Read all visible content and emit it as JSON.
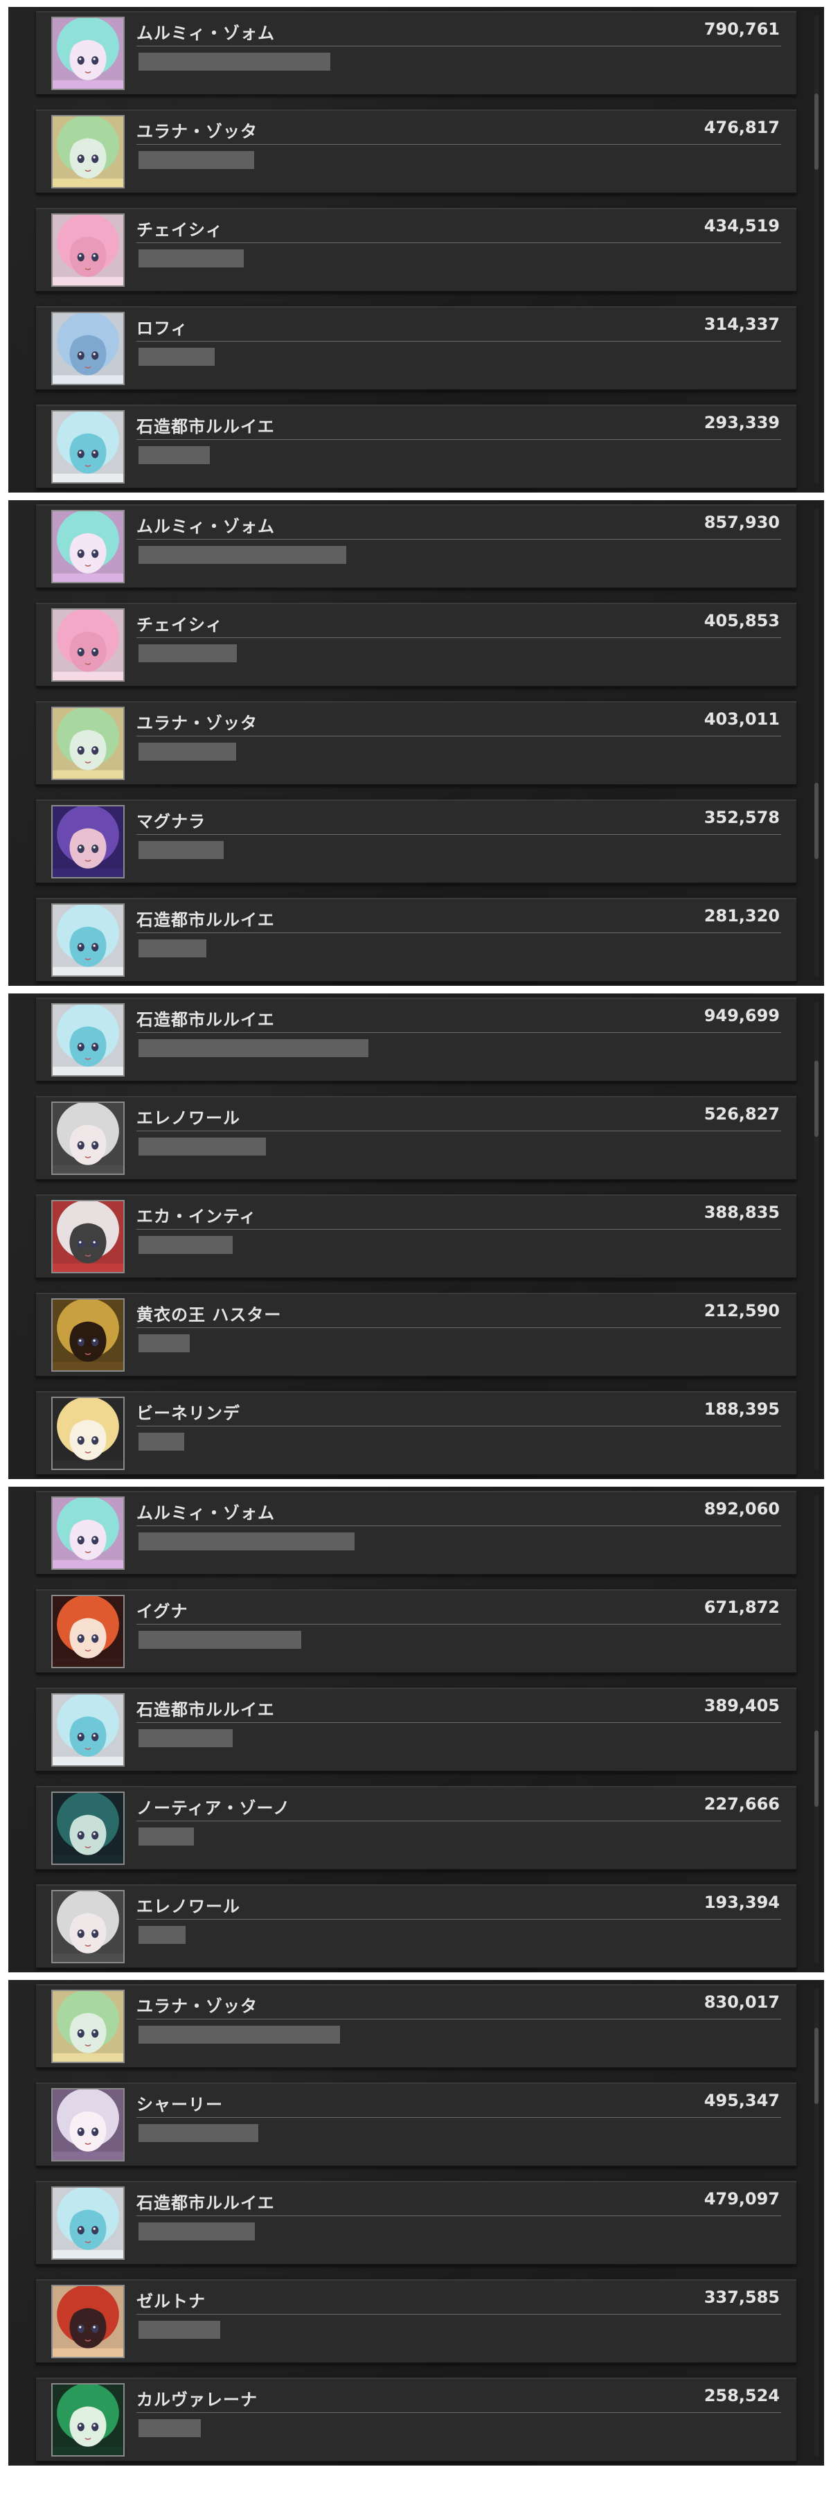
{
  "bar_max": 1000000,
  "panels": [
    {
      "scroll_fraction": 0.2,
      "entries": [
        {
          "name": "ムルミィ・ゾォム",
          "score": "790,761",
          "value": 790761,
          "avatar": "portrait-teal-hair",
          "colors": [
            "#8fe0d8",
            "#e0b8e8",
            "#f4e6f4"
          ]
        },
        {
          "name": "ユラナ・ゾッタ",
          "score": "476,817",
          "value": 476817,
          "avatar": "portrait-green-hair",
          "colors": [
            "#a8d8a0",
            "#f0e0a0",
            "#dfeee0"
          ]
        },
        {
          "name": "チェイシィ",
          "score": "434,519",
          "value": 434519,
          "avatar": "portrait-pink-hair",
          "colors": [
            "#f4a8c8",
            "#fce0ec",
            "#e89ab8"
          ]
        },
        {
          "name": "ロフィ",
          "score": "314,337",
          "value": 314337,
          "avatar": "portrait-silver-hair",
          "colors": [
            "#a8c8e8",
            "#e8f0f8",
            "#7fa8d0"
          ]
        },
        {
          "name": "石造都市ルルイエ",
          "score": "293,339",
          "value": 293339,
          "avatar": "portrait-cyan-white-hair",
          "colors": [
            "#bfe8f0",
            "#f0f4f8",
            "#6fc8d8"
          ]
        }
      ]
    },
    {
      "scroll_fraction": 0.7,
      "entries": [
        {
          "name": "ムルミィ・ゾォム",
          "score": "857,930",
          "value": 857930,
          "avatar": "portrait-teal-hair",
          "colors": [
            "#8fe0d8",
            "#e0b8e8",
            "#f4e6f4"
          ]
        },
        {
          "name": "チェイシィ",
          "score": "405,853",
          "value": 405853,
          "avatar": "portrait-pink-hair",
          "colors": [
            "#f4a8c8",
            "#fce0ec",
            "#e89ab8"
          ]
        },
        {
          "name": "ユラナ・ゾッタ",
          "score": "403,011",
          "value": 403011,
          "avatar": "portrait-green-hair",
          "colors": [
            "#a8d8a0",
            "#f0e0a0",
            "#dfeee0"
          ]
        },
        {
          "name": "マグナラ",
          "score": "352,578",
          "value": 352578,
          "avatar": "portrait-purple-hair",
          "colors": [
            "#6a4ab0",
            "#3a2a78",
            "#e8c0d0"
          ]
        },
        {
          "name": "石造都市ルルイエ",
          "score": "281,320",
          "value": 281320,
          "avatar": "portrait-cyan-white-hair",
          "colors": [
            "#bfe8f0",
            "#f0f4f8",
            "#6fc8d8"
          ]
        }
      ]
    },
    {
      "scroll_fraction": 0.15,
      "entries": [
        {
          "name": "石造都市ルルイエ",
          "score": "949,699",
          "value": 949699,
          "avatar": "portrait-cyan-white-hair",
          "colors": [
            "#bfe8f0",
            "#f0f4f8",
            "#6fc8d8"
          ]
        },
        {
          "name": "エレノワール",
          "score": "526,827",
          "value": 526827,
          "avatar": "portrait-white-hair-dark",
          "colors": [
            "#d8d8d8",
            "#505050",
            "#f0e8e8"
          ]
        },
        {
          "name": "エカ・インティ",
          "score": "388,835",
          "value": 388835,
          "avatar": "portrait-white-hair-red",
          "colors": [
            "#e8e0e0",
            "#c84040",
            "#404040"
          ]
        },
        {
          "name": "黄衣の王 ハスター",
          "score": "212,590",
          "value": 212590,
          "avatar": "portrait-golden-creature",
          "colors": [
            "#c8a040",
            "#6a5020",
            "#2a1a10"
          ]
        },
        {
          "name": "ビーネリンデ",
          "score": "188,395",
          "value": 188395,
          "avatar": "portrait-blonde-hair",
          "colors": [
            "#f0d890",
            "#303030",
            "#f8f0e0"
          ]
        }
      ]
    },
    {
      "scroll_fraction": 0.6,
      "entries": [
        {
          "name": "ムルミィ・ゾォム",
          "score": "892,060",
          "value": 892060,
          "avatar": "portrait-teal-hair",
          "colors": [
            "#8fe0d8",
            "#e0b8e8",
            "#f4e6f4"
          ]
        },
        {
          "name": "イグナ",
          "score": "671,872",
          "value": 671872,
          "avatar": "portrait-red-hair",
          "colors": [
            "#e05a30",
            "#3a1a18",
            "#f8e0d0"
          ]
        },
        {
          "name": "石造都市ルルイエ",
          "score": "389,405",
          "value": 389405,
          "avatar": "portrait-cyan-white-hair",
          "colors": [
            "#bfe8f0",
            "#f0f4f8",
            "#6fc8d8"
          ]
        },
        {
          "name": "ノーティア・ゾーノ",
          "score": "227,666",
          "value": 227666,
          "avatar": "portrait-dark-teal-hair",
          "colors": [
            "#2a6a68",
            "#1a2a30",
            "#c8e0d8"
          ]
        },
        {
          "name": "エレノワール",
          "score": "193,394",
          "value": 193394,
          "avatar": "portrait-white-hair-dark",
          "colors": [
            "#d8d8d8",
            "#505050",
            "#f0e8e8"
          ]
        }
      ]
    },
    {
      "scroll_fraction": 0.1,
      "entries": [
        {
          "name": "ユラナ・ゾッタ",
          "score": "830,017",
          "value": 830017,
          "avatar": "portrait-green-hair",
          "colors": [
            "#a8d8a0",
            "#f0e0a0",
            "#dfeee0"
          ]
        },
        {
          "name": "シャーリー",
          "score": "495,347",
          "value": 495347,
          "avatar": "portrait-silver-lilac-hair",
          "colors": [
            "#e0d8e8",
            "#8a7098",
            "#f8f0f4"
          ]
        },
        {
          "name": "石造都市ルルイエ",
          "score": "479,097",
          "value": 479097,
          "avatar": "portrait-cyan-white-hair",
          "colors": [
            "#bfe8f0",
            "#f0f4f8",
            "#6fc8d8"
          ]
        },
        {
          "name": "ゼルトナ",
          "score": "337,585",
          "value": 337585,
          "avatar": "portrait-red-cap",
          "colors": [
            "#c83a28",
            "#f0c8a0",
            "#3a2020"
          ]
        },
        {
          "name": "カルヴァレーナ",
          "score": "258,524",
          "value": 258524,
          "avatar": "portrait-green-hair-dark",
          "colors": [
            "#2a9a5a",
            "#1a3a28",
            "#e0f0e0"
          ]
        }
      ]
    }
  ]
}
